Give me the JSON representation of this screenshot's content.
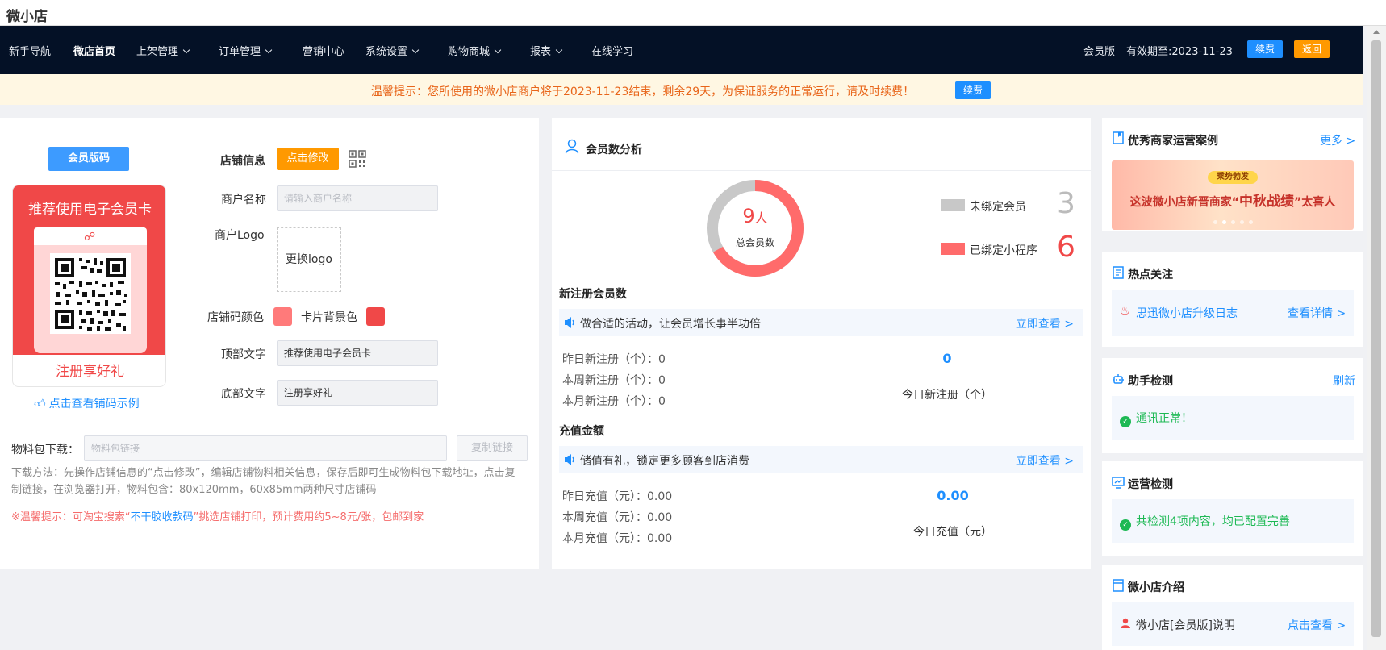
{
  "app": {
    "title": "微小店"
  },
  "nav": {
    "items": [
      {
        "label": "新手导航",
        "chevron": false
      },
      {
        "label": "微店首页",
        "chevron": false,
        "active": true
      },
      {
        "label": "上架管理",
        "chevron": true
      },
      {
        "label": "订单管理",
        "chevron": true
      },
      {
        "label": "营销中心",
        "chevron": false
      },
      {
        "label": "系统设置",
        "chevron": true
      },
      {
        "label": "购物商城",
        "chevron": true
      },
      {
        "label": "报表",
        "chevron": true
      },
      {
        "label": "在线学习",
        "chevron": false
      }
    ],
    "edition": "会员版",
    "expiry": "有效期至:2023-11-23",
    "renew_label": "续费",
    "back_label": "返回"
  },
  "notice": {
    "text": "温馨提示：您所使用的微小店商户将于2023-11-23结束，剩余29天，为保证服务的正常运行，请及时续费！",
    "renew_label": "续费"
  },
  "store_card": {
    "tab_label": "会员版码",
    "card_top_text": "推荐使用电子会员卡",
    "card_bottom_text": "注册享好礼",
    "example_link": "点击查看铺码示例",
    "store_info_label": "店铺信息",
    "edit_button": "点击修改",
    "merchant_name_label": "商户名称",
    "merchant_name_placeholder": "请输入商户名称",
    "logo_label": "商户Logo",
    "logo_button": "更换logo",
    "code_color_label": "店铺码颜色",
    "code_color": "#ff7a7a",
    "card_bg_label": "卡片背景色",
    "card_bg_color": "#f04848",
    "top_text_label": "顶部文字",
    "top_text_value": "推荐使用电子会员卡",
    "bottom_text_label": "底部文字",
    "bottom_text_value": "注册享好礼",
    "material_label": "物料包下载：",
    "material_placeholder": "物料包链接",
    "copy_button": "复制链接",
    "download_desc": "下载方法：先操作店铺信息的“点击修改”，编辑店铺物料相关信息，保存后即可生成物料包下载地址，点击复制链接，在浏览器打开，物料包含：80x120mm，60x85mm两种尺寸店铺码",
    "tip_prefix": "※温馨提示：可淘宝搜索“",
    "tip_keyword": "不干胶收款码",
    "tip_suffix": "”挑选店铺打印，预计费用约5~8元/张，包邮到家"
  },
  "member_analysis": {
    "title": "会员数分析",
    "donut_number": "9",
    "donut_unit": "人",
    "donut_label": "总会员数",
    "legend": [
      {
        "label": "未绑定会员",
        "value": "3",
        "color": "#c8c8c8"
      },
      {
        "label": "已绑定小程序",
        "value": "6",
        "color": "#ff6b6b"
      }
    ],
    "new_reg_title": "新注册会员数",
    "new_reg_bar_text": "做合适的活动，让会员增长事半功倍",
    "new_reg_bar_link": "立即查看 >",
    "new_reg_stats": [
      "昨日新注册（个）：0",
      "本周新注册（个）：0",
      "本月新注册（个）：0"
    ],
    "new_reg_today_value": "0",
    "new_reg_today_label": "今日新注册（个）",
    "recharge_title": "充值金额",
    "recharge_bar_text": "储值有礼，锁定更多顾客到店消费",
    "recharge_bar_link": "立即查看 >",
    "recharge_stats": [
      "昨日充值（元）：0.00",
      "本周充值（元）：0.00",
      "本月充值（元）：0.00"
    ],
    "recharge_today_value": "0.00",
    "recharge_today_label": "今日充值（元）"
  },
  "sidebar": {
    "cases_title": "优秀商家运营案例",
    "cases_more": "更多 >",
    "banner_tag": "乘势勃发",
    "banner_text_a": "这波微小店新晋商家“",
    "banner_text_b": "中秋战绩",
    "banner_text_c": "”太喜人",
    "hot_title": "热点关注",
    "hot_item": "思迅微小店升级日志",
    "hot_link": "查看详情 >",
    "assist_title": "助手检测",
    "assist_refresh": "刷新",
    "assist_status": "通讯正常！",
    "ops_title": "运营检测",
    "ops_status": "共检测4项内容，均已配置完善",
    "intro_title": "微小店介绍",
    "intro_item": "微小店[会员版]说明",
    "intro_link": "点击查看 >"
  }
}
